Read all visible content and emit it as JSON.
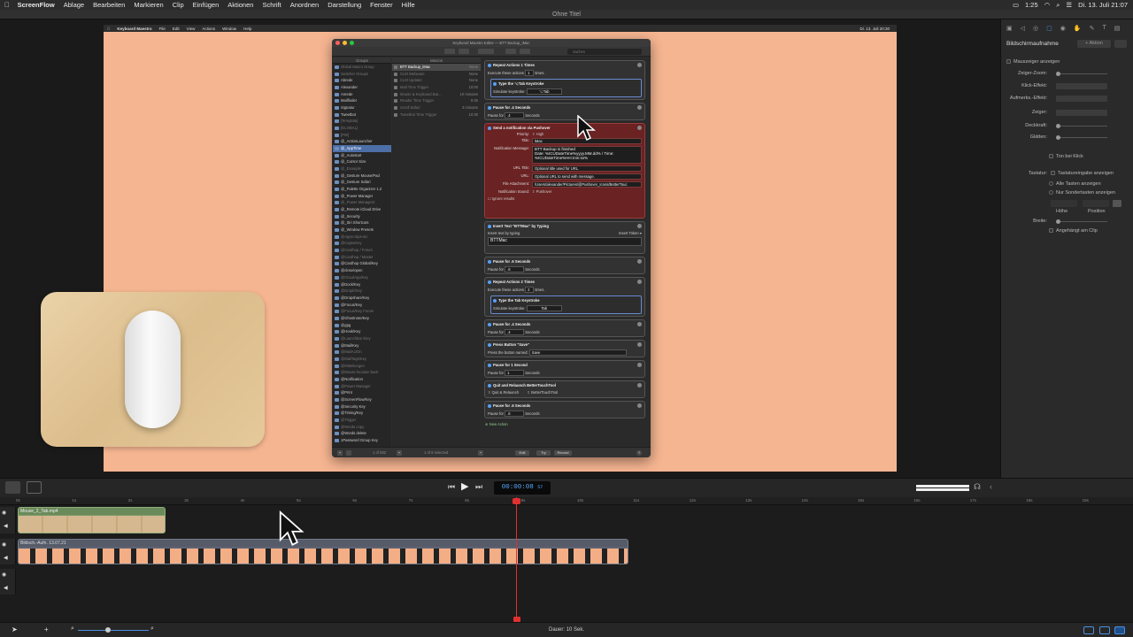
{
  "menubar": {
    "app_name": "ScreenFlow",
    "items": [
      "Ablage",
      "Bearbeiten",
      "Markieren",
      "Clip",
      "Einfügen",
      "Aktionen",
      "Schrift",
      "Anordnen",
      "Darstellung",
      "Fenster",
      "Hilfe"
    ],
    "time": "1:25",
    "date": "Di. 13. Juli  21:07"
  },
  "window_title": "Ohne Titel",
  "recording": {
    "menubar_app": "Keyboard Maestro",
    "menubar_items": [
      "File",
      "Edit",
      "View",
      "Actions",
      "Window",
      "Help"
    ],
    "menubar_right": "Di. 13. Juli  20:30",
    "km_title": "Keyboard Maestro Editor — BTT Backup_iMac",
    "search_placeholder": "Suchen",
    "groups_header": "Groups",
    "macros_header": "Macros",
    "groups": [
      {
        "label": "Global Macro Group",
        "dim": true
      },
      {
        "label": "Switcher Groups",
        "dim": true
      },
      {
        "label": "Abrede",
        "dim": false
      },
      {
        "label": "Alexander",
        "dim": false
      },
      {
        "label": "Anrede",
        "dim": false
      },
      {
        "label": "Mailfinder",
        "dim": false
      },
      {
        "label": "Signatur",
        "dim": false
      },
      {
        "label": "Tweetbot",
        "dim": false
      },
      {
        "label": "[Template]",
        "dim": true
      },
      {
        "label": "[GLOBAL]",
        "dim": true
      },
      {
        "label": "[PW]",
        "dim": true
      },
      {
        "label": "@_ActionLauncher",
        "dim": false
      },
      {
        "label": "@_AppTime",
        "sel": true
      },
      {
        "label": "@_Autostart",
        "dim": false
      },
      {
        "label": "@_Cursor Size",
        "dim": false
      },
      {
        "label": "@_Example",
        "dim": true
      },
      {
        "label": "@_Gesture Mouse/Pad",
        "dim": false
      },
      {
        "label": "@_Gesture Safari",
        "dim": false
      },
      {
        "label": "@_Palette Organizer 1.2",
        "dim": false
      },
      {
        "label": "@_Power Manager",
        "dim": false
      },
      {
        "label": "@_Power Manager2",
        "dim": true
      },
      {
        "label": "@_Remote iCloud Drive",
        "dim": false
      },
      {
        "label": "@_Security",
        "dim": false
      },
      {
        "label": "@_Siri Shortcuts",
        "dim": false
      },
      {
        "label": "@_Window Presets",
        "dim": false
      },
      {
        "label": "@Apps-clips-etc",
        "dim": true
      },
      {
        "label": "@CapsuKey",
        "dim": true
      },
      {
        "label": "@Cardhop / Forum",
        "dim": true
      },
      {
        "label": "@Cardhop / Master",
        "dim": true
      },
      {
        "label": "@Cardhop Global/Key",
        "dim": false
      },
      {
        "label": "@close/open",
        "dim": false
      },
      {
        "label": "@CloudApp/Key",
        "dim": true
      },
      {
        "label": "@Dock/Key",
        "dim": false
      },
      {
        "label": "@Droplr/Key",
        "dim": true
      },
      {
        "label": "@Dropshare/Key",
        "dim": false
      },
      {
        "label": "@Focus/Key",
        "dim": false
      },
      {
        "label": "@Focus/Key Forum",
        "dim": true
      },
      {
        "label": "@Ghostnote/Key",
        "dim": false
      },
      {
        "label": "@gpg",
        "dim": false
      },
      {
        "label": "@Hook/Key",
        "dim": false
      },
      {
        "label": "@Launchbar /Key",
        "dim": true
      },
      {
        "label": "@Mail/Key",
        "dim": false
      },
      {
        "label": "@MailActOn",
        "dim": true
      },
      {
        "label": "@MailTags/Key",
        "dim": true
      },
      {
        "label": "@Mitteilungen",
        "dim": true
      },
      {
        "label": "@Mouse location back",
        "dim": true
      },
      {
        "label": "@Notification",
        "dim": false
      },
      {
        "label": "@Power Manager",
        "dim": true
      },
      {
        "label": "@Print",
        "dim": false
      },
      {
        "label": "@ScreenFlow/Key",
        "dim": false
      },
      {
        "label": "@Security Key",
        "dim": false
      },
      {
        "label": "@Timing/Key",
        "dim": false
      },
      {
        "label": "@Trigger",
        "dim": true
      },
      {
        "label": "@Words copy",
        "dim": true
      },
      {
        "label": "@Words delete",
        "dim": false
      },
      {
        "label": "1Password Group Key",
        "dim": false
      }
    ],
    "macros": [
      {
        "label": "BTT Backup_iMac",
        "status": "None",
        "sel": true
      },
      {
        "label": "CLM Webware",
        "status": "None",
        "dim": true
      },
      {
        "label": "CLM Updater",
        "status": "None",
        "dim": true
      },
      {
        "label": "Mail Time Trigger",
        "status": "10:00",
        "dim": true
      },
      {
        "label": "Mouse & Keyboard Bat...",
        "status": "10 minutes",
        "dim": true
      },
      {
        "label": "Reader Time Trigger",
        "status": "9:30",
        "dim": true
      },
      {
        "label": "Scroll Safari",
        "status": "3 minutes",
        "dim": true
      },
      {
        "label": "Tweetbot Time Trigger",
        "status": "10:30",
        "dim": true
      }
    ],
    "actions": {
      "repeat1_title": "Repeat Actions 1 Times",
      "repeat1_execute": "Execute these actions",
      "repeat1_count": "1",
      "times": "times.",
      "type_opt_title": "Type the ⌥Tab Keystroke",
      "simulate_label": "Simulate keystroke:",
      "simulate1_value": "⌥Tab",
      "pause1_title": "Pause for .4 Seconds",
      "pause_for": "Pause for",
      "pause1_value": ".4",
      "seconds": "Seconds",
      "notify_title": "Send a notification via Pushover",
      "priority_label": "Priority:",
      "priority_value": "⇧ High",
      "title_label": "Title:",
      "title_value": "iMac",
      "message_label": "Notification Message:",
      "message_value": "BTT Backup is finished\nDate: %ICUDateTime%yyyy.MM.dd% / Time: %ICUDateTime%HH:mm:ss%",
      "url_title_label": "URL Title:",
      "url_title_value": "Optional title used for URL.",
      "url_label": "URL:",
      "url_value": "Optional URL to send with message.",
      "attach_label": "File Attachment:",
      "attach_value": "/Users/alexander/Pictures/@Pushover_Icons/BetterTouc",
      "sound_label": "Notification Sound:",
      "sound_value": "⇧ Pushover",
      "ignore_results": "☐ Ignore results",
      "insert_title": "Insert Text \"BTTMac\" by Typing",
      "insert_by": "Insert text by typing",
      "insert_token": "Insert Token ▾",
      "insert_value": "BTTMac",
      "pause2_title": "Pause for .6 Seconds",
      "pause2_value": ".6",
      "repeat2_title": "Repeat Actions 2 Times",
      "repeat2_count": "2",
      "type_tab_title": "Type the Tab Keystroke",
      "simulate2_value": "Tab",
      "pause3_title": "Pause for .4 Seconds",
      "pause3_value": ".4",
      "press_title": "Press Button \"Save\"",
      "press_label": "Press the button named:",
      "press_value": "Save",
      "pause4_title": "Pause for 1 Second",
      "pause4_value": "1",
      "quit_title": "Quit and Relaunch BetterTouchTool",
      "quit_option": "⇧ Quit & Relaunch",
      "quit_app": "⇧ BetterTouchTool",
      "pause5_title": "Pause for .6 Seconds",
      "pause5_value": ".6",
      "new_action": "⊕ New Action"
    },
    "bottom": {
      "groups_count": "1 of 582",
      "macros_count": "1 of 8 selected",
      "edit": "Edit",
      "try": "Try",
      "record": "Record"
    }
  },
  "inspector": {
    "title": "Bildschirmaufnahme",
    "add_action": "+ Aktion",
    "show_pointer": "Mauszeiger anzeigen",
    "pointer_zoom": "Zeiger-Zoom:",
    "click_effect": "Klick-Effekt:",
    "attention_effect": "Aufmerks.-Effekt:",
    "pointer": "Zeiger:",
    "opacity": "Deckkraft:",
    "smooth": "Glätten:",
    "click_sound": "Ton bei Klick",
    "keyboard": "Tastatur:",
    "show_keystrokes": "Tastatureingabe anzeigen",
    "all_keys": "Alle Tasten anzeigen",
    "special_keys": "Nur Sondertasten anzeigen",
    "height": "Höhe",
    "position": "Position",
    "width": "Breite:",
    "attached": "Angehängt am Clip"
  },
  "transport": {
    "timecode": "00:00:08",
    "frames": "57"
  },
  "ruler_ticks": [
    "0s",
    "1s",
    "2s",
    "3s",
    "4s",
    "5s",
    "6s",
    "7s",
    "8s",
    "9s",
    "10s",
    "11s",
    "12s",
    "13s",
    "14s",
    "15s",
    "16s",
    "17s",
    "18s",
    "19s"
  ],
  "clips": {
    "clip1_name": "Mouse_2_Tab.mp4",
    "clip2_name": "Bildsch.-Aufn. 13.07.21"
  },
  "status": {
    "duration": "Dauer: 10 Sek."
  }
}
